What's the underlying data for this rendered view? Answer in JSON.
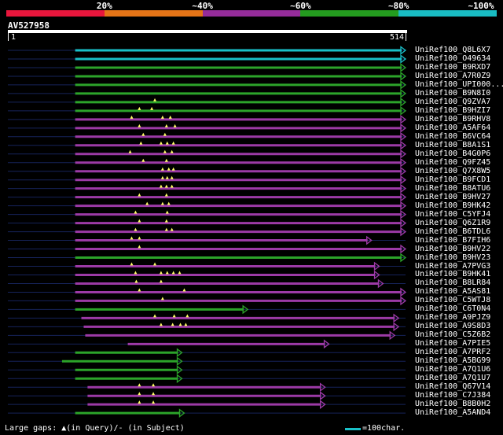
{
  "query": {
    "name": "AV527958",
    "start": "1",
    "end": "514",
    "length": 514
  },
  "colorbar": {
    "segments": [
      {
        "color": "#e8163c",
        "frac": 0.2
      },
      {
        "color": "#e47417",
        "frac": 0.2
      },
      {
        "color": "#952c9a",
        "frac": 0.2
      },
      {
        "color": "#249c1f",
        "frac": 0.2
      },
      {
        "color": "#19bcc3",
        "frac": 0.2
      }
    ],
    "labels": [
      "20%",
      "~40%",
      "~60%",
      "~80%",
      "~100%"
    ]
  },
  "colors": {
    "cyan": "#19c0c8",
    "green": "#2ca42a",
    "purple": "#9c3aa6",
    "navy": "#16235a",
    "marker": "#ffff66"
  },
  "hits": [
    {
      "label": "UniRef100_Q8L6X7",
      "color": "cyan",
      "start": 87,
      "end": 514,
      "markers": []
    },
    {
      "label": "UniRef100_O49634",
      "color": "cyan",
      "start": 87,
      "end": 514,
      "markers": []
    },
    {
      "label": "UniRef100_B9RXD7",
      "color": "green",
      "start": 87,
      "end": 514,
      "markers": []
    },
    {
      "label": "UniRef100_A7R0Z9",
      "color": "green",
      "start": 87,
      "end": 514,
      "markers": []
    },
    {
      "label": "UniRef100_UPI000...",
      "color": "green",
      "start": 87,
      "end": 514,
      "markers": []
    },
    {
      "label": "UniRef100_B9N8I0",
      "color": "green",
      "start": 87,
      "end": 514,
      "markers": []
    },
    {
      "label": "UniRef100_Q9ZVA7",
      "color": "green",
      "start": 87,
      "end": 514,
      "markers": [
        190
      ]
    },
    {
      "label": "UniRef100_B9HZI7",
      "color": "green",
      "start": 87,
      "end": 514,
      "markers": [
        170,
        186
      ]
    },
    {
      "label": "UniRef100_B9RHV8",
      "color": "purple",
      "start": 87,
      "end": 514,
      "markers": [
        160,
        200,
        210
      ]
    },
    {
      "label": "UniRef100_A5AF64",
      "color": "purple",
      "start": 87,
      "end": 514,
      "markers": [
        170,
        205,
        216
      ]
    },
    {
      "label": "UniRef100_B6VC64",
      "color": "purple",
      "start": 87,
      "end": 514,
      "markers": [
        175,
        203
      ]
    },
    {
      "label": "UniRef100_B8A1S1",
      "color": "purple",
      "start": 87,
      "end": 514,
      "markers": [
        172,
        198,
        206,
        214
      ]
    },
    {
      "label": "UniRef100_B4G0P6",
      "color": "purple",
      "start": 87,
      "end": 514,
      "markers": [
        158,
        203,
        212
      ]
    },
    {
      "label": "UniRef100_Q9FZ45",
      "color": "purple",
      "start": 87,
      "end": 514,
      "markers": [
        175,
        205
      ]
    },
    {
      "label": "UniRef100_Q7X8W5",
      "color": "purple",
      "start": 87,
      "end": 514,
      "markers": [
        200,
        208,
        214
      ]
    },
    {
      "label": "UniRef100_B9FCD1",
      "color": "purple",
      "start": 87,
      "end": 514,
      "markers": [
        200,
        206,
        212
      ]
    },
    {
      "label": "UniRef100_B8ATU6",
      "color": "purple",
      "start": 87,
      "end": 514,
      "markers": [
        198,
        205,
        212
      ]
    },
    {
      "label": "UniRef100_B9HV27",
      "color": "purple",
      "start": 87,
      "end": 514,
      "markers": [
        170,
        205
      ]
    },
    {
      "label": "UniRef100_B9HK42",
      "color": "purple",
      "start": 87,
      "end": 514,
      "markers": [
        180,
        200,
        208
      ]
    },
    {
      "label": "UniRef100_C5YFJ4",
      "color": "purple",
      "start": 87,
      "end": 514,
      "markers": [
        165,
        206
      ]
    },
    {
      "label": "UniRef100_Q6Z1R9",
      "color": "purple",
      "start": 87,
      "end": 514,
      "markers": [
        170,
        205
      ]
    },
    {
      "label": "UniRef100_B6TDL6",
      "color": "purple",
      "start": 87,
      "end": 514,
      "markers": [
        165,
        205,
        212
      ]
    },
    {
      "label": "UniRef100_B7FIH6",
      "color": "purple",
      "start": 87,
      "end": 470,
      "markers": [
        160,
        170
      ]
    },
    {
      "label": "UniRef100_B9HV22",
      "color": "purple",
      "start": 87,
      "end": 514,
      "markers": [
        170
      ]
    },
    {
      "label": "UniRef100_B9HV23",
      "color": "green",
      "start": 87,
      "end": 514,
      "markers": []
    },
    {
      "label": "UniRef100_A7PVG3",
      "color": "purple",
      "start": 87,
      "end": 480,
      "markers": [
        160,
        190
      ]
    },
    {
      "label": "UniRef100_B9HK41",
      "color": "purple",
      "start": 87,
      "end": 480,
      "markers": [
        165,
        198,
        206,
        214,
        222
      ]
    },
    {
      "label": "UniRef100_B8LR84",
      "color": "purple",
      "start": 87,
      "end": 485,
      "markers": [
        166,
        198
      ]
    },
    {
      "label": "UniRef100_A5AS81",
      "color": "purple",
      "start": 87,
      "end": 514,
      "markers": [
        170,
        228
      ]
    },
    {
      "label": "UniRef100_C5WTJ8",
      "color": "purple",
      "start": 87,
      "end": 514,
      "markers": [
        200
      ]
    },
    {
      "label": "UniRef100_C6T0N4",
      "color": "green",
      "start": 87,
      "end": 310,
      "markers": []
    },
    {
      "label": "UniRef100_A9PJZ9",
      "color": "purple",
      "start": 95,
      "end": 505,
      "markers": [
        190,
        215,
        232
      ]
    },
    {
      "label": "UniRef100_A9S8D3",
      "color": "purple",
      "start": 98,
      "end": 505,
      "markers": [
        198,
        213,
        223,
        230
      ]
    },
    {
      "label": "UniRef100_C5Z6B2",
      "color": "purple",
      "start": 100,
      "end": 500,
      "markers": []
    },
    {
      "label": "UniRef100_A7PIE5",
      "color": "purple",
      "start": 155,
      "end": 415,
      "markers": []
    },
    {
      "label": "UniRef100_A7PRF2",
      "color": "green",
      "start": 87,
      "end": 225,
      "markers": []
    },
    {
      "label": "UniRef100_A5BG99",
      "color": "green",
      "start": 70,
      "end": 225,
      "markers": []
    },
    {
      "label": "UniRef100_A7Q1U6",
      "color": "green",
      "start": 87,
      "end": 225,
      "markers": []
    },
    {
      "label": "UniRef100_A7Q1U7",
      "color": "green",
      "start": 87,
      "end": 225,
      "markers": []
    },
    {
      "label": "UniRef100_Q67V14",
      "color": "purple",
      "start": 103,
      "end": 410,
      "markers": [
        170,
        188
      ]
    },
    {
      "label": "UniRef100_C7J384",
      "color": "purple",
      "start": 103,
      "end": 410,
      "markers": [
        170,
        188
      ]
    },
    {
      "label": "UniRef100_B8B0H2",
      "color": "purple",
      "start": 103,
      "end": 410,
      "markers": [
        170,
        188
      ]
    },
    {
      "label": "UniRef100_A5AND4",
      "color": "green",
      "start": 87,
      "end": 228,
      "markers": []
    }
  ],
  "legend": {
    "text": "Large gaps: ▲(in Query)/- (in Subject)",
    "scale_label": "=100char."
  }
}
